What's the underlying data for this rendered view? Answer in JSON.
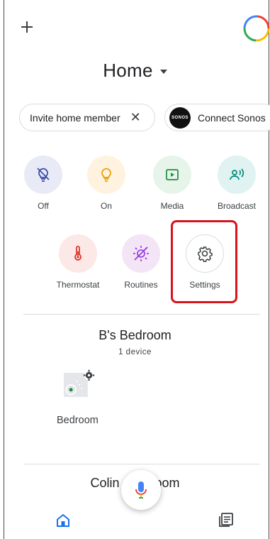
{
  "header": {
    "title": "Home",
    "add_icon": "plus-icon",
    "avatar_icon": "google-account-ring"
  },
  "chips": {
    "invite_label": "Invite home member",
    "invite_dismiss": "✕",
    "sonos_logo_text": "SONOS",
    "sonos_label": "Connect Sonos"
  },
  "actions": [
    {
      "label": "Off",
      "icon": "light-off-icon",
      "bg": "#e8eaf6",
      "fg": "#3949ab"
    },
    {
      "label": "On",
      "icon": "light-on-icon",
      "bg": "#fff3e0",
      "fg": "#e8a000"
    },
    {
      "label": "Media",
      "icon": "media-icon",
      "bg": "#e6f4ea",
      "fg": "#1e8e3e"
    },
    {
      "label": "Broadcast",
      "icon": "broadcast-icon",
      "bg": "#e0f2f1",
      "fg": "#00897b"
    },
    {
      "label": "Thermostat",
      "icon": "thermometer-icon",
      "bg": "#fce8e6",
      "fg": "#d93025"
    },
    {
      "label": "Routines",
      "icon": "routines-icon",
      "bg": "#f3e5f5",
      "fg": "#9334e6"
    },
    {
      "label": "Settings",
      "icon": "gear-icon",
      "bg": "#ffffff",
      "fg": "#3c4043"
    }
  ],
  "room": {
    "name": "B's Bedroom",
    "count": "1 device",
    "device_label": "Bedroom"
  },
  "room2": {
    "name": "Colin's Bedroom",
    "name_left": "Colin",
    "name_right": "room"
  },
  "colors": {
    "accent": "#1a73e8",
    "highlight": "#d9131e",
    "divider": "#dadce0"
  }
}
